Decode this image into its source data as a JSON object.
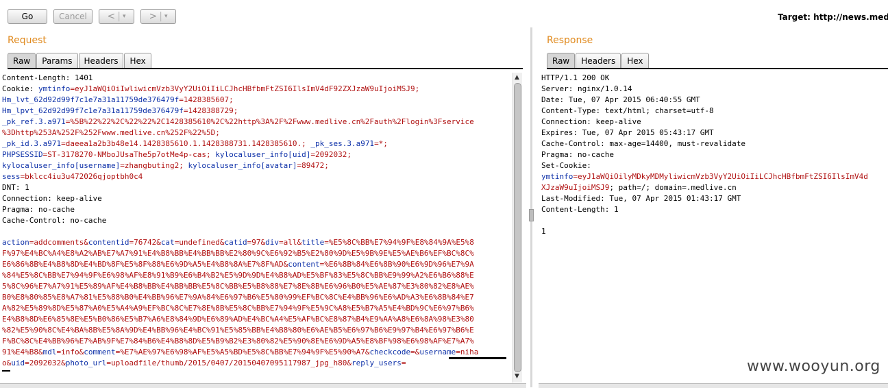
{
  "toolbar": {
    "go_label": "Go",
    "cancel_label": "Cancel",
    "back_label": "<",
    "forward_label": ">",
    "dropdown_glyph": "▾",
    "target_text": "Target: http://news.medlive.c"
  },
  "request": {
    "title": "Request",
    "tabs": [
      "Raw",
      "Params",
      "Headers",
      "Hex"
    ],
    "lines": [
      [
        {
          "t": "Content-Length: 1401",
          "c": "p"
        }
      ],
      [
        {
          "t": "Cookie: ",
          "c": "p"
        },
        {
          "t": "ymtinfo",
          "c": "k"
        },
        {
          "t": "=eyJ1aWQiOiIwliwicmVzb3VyY2UiOiIiLCJhcHBfbmFtZSI6IlsImV4dF92ZXJzaW9uIjoiMSJ9;",
          "c": "v"
        }
      ],
      [
        {
          "t": "Hm_lvt_62d92d99f7c1e7a31a11759de376479f",
          "c": "k"
        },
        {
          "t": "=1428385607;",
          "c": "v"
        }
      ],
      [
        {
          "t": "Hm_lpvt_62d92d99f7c1e7a31a11759de376479f",
          "c": "k"
        },
        {
          "t": "=1428388729;",
          "c": "v"
        }
      ],
      [
        {
          "t": "_pk_ref.3.a971",
          "c": "k"
        },
        {
          "t": "=%5B%22%22%2C%22%22%2C1428385610%2C%22http%3A%2F%2Fwww.medlive.cn%2Fauth%2Flogin%3Fservice",
          "c": "v"
        }
      ],
      [
        {
          "t": "%3Dhttp%253A%252F%252Fwww.medlive.cn%252F%22%5D;",
          "c": "v"
        }
      ],
      [
        {
          "t": "_pk_id.3.a971",
          "c": "k"
        },
        {
          "t": "=daeea1a2b3b48e14.1428385610.1.1428388731.1428385610.; ",
          "c": "v"
        },
        {
          "t": "_pk_ses.3.a971",
          "c": "k"
        },
        {
          "t": "=*;",
          "c": "v"
        }
      ],
      [
        {
          "t": "PHPSESSID",
          "c": "k"
        },
        {
          "t": "=ST-3178270-NMboJUsaThe5p7otMe4p-cas; ",
          "c": "v"
        },
        {
          "t": "kylocaluser_info[uid]",
          "c": "k"
        },
        {
          "t": "=2092032;",
          "c": "v"
        }
      ],
      [
        {
          "t": "kylocaluser_info[username]",
          "c": "k"
        },
        {
          "t": "=zhangbuting2; ",
          "c": "v"
        },
        {
          "t": "kylocaluser_info[avatar]",
          "c": "k"
        },
        {
          "t": "=89472;",
          "c": "v"
        }
      ],
      [
        {
          "t": "sess",
          "c": "k"
        },
        {
          "t": "=bklcc4iu3u472026qjoptbh0c4",
          "c": "v"
        }
      ],
      [
        {
          "t": "DNT: 1",
          "c": "p"
        }
      ],
      [
        {
          "t": "Connection: keep-alive",
          "c": "p"
        }
      ],
      [
        {
          "t": "Pragma: no-cache",
          "c": "p"
        }
      ],
      [
        {
          "t": "Cache-Control: no-cache",
          "c": "p"
        }
      ],
      [
        {
          "t": "",
          "c": "p"
        }
      ],
      [
        {
          "t": "action",
          "c": "k"
        },
        {
          "t": "=addcomments&",
          "c": "v"
        },
        {
          "t": "contentid",
          "c": "k"
        },
        {
          "t": "=76742&",
          "c": "v"
        },
        {
          "t": "cat",
          "c": "k"
        },
        {
          "t": "=undefined&",
          "c": "v"
        },
        {
          "t": "catid",
          "c": "k"
        },
        {
          "t": "=97&",
          "c": "v"
        },
        {
          "t": "div",
          "c": "k"
        },
        {
          "t": "=all&",
          "c": "v"
        },
        {
          "t": "title",
          "c": "k"
        },
        {
          "t": "=%E5%8C%BB%E7%94%9F%E8%84%9A%E5%8",
          "c": "v"
        }
      ],
      [
        {
          "t": "F%97%E4%BC%A4%E8%A2%AB%E7%A7%91%E4%B8%BB%E4%BB%BB%E2%80%9C%E6%92%B5%E2%80%9D%E5%9B%9E%E5%AE%B6%EF%BC%8C%",
          "c": "v"
        }
      ],
      [
        {
          "t": "E6%86%8B%E4%B8%8D%E4%BD%8F%E5%8F%88%E6%9D%A5%E4%B8%8A%E7%8F%AD&",
          "c": "v"
        },
        {
          "t": "content",
          "c": "k"
        },
        {
          "t": "=%E6%8B%84%E6%8B%90%E6%9D%96%E7%9A",
          "c": "v"
        }
      ],
      [
        {
          "t": "%84%E5%8C%BB%E7%94%9F%E6%98%AF%E8%91%B9%E6%B4%B2%E5%9D%9D%E4%B8%AD%E5%BF%83%E5%8C%BB%E9%99%A2%E6%B6%88%E",
          "c": "v"
        }
      ],
      [
        {
          "t": "5%8C%96%E7%A7%91%E5%89%AF%E4%B8%BB%E4%BB%BB%E5%8C%BB%E5%B8%88%E7%8E%8B%E6%96%B0%E5%AE%87%E3%80%82%E8%AE%",
          "c": "v"
        }
      ],
      [
        {
          "t": "B0%E8%80%85%E8%A7%81%E5%88%B0%E4%BB%96%E7%9A%84%E6%97%B6%E5%80%99%EF%BC%8C%E4%BB%96%E6%AD%A3%E6%8B%84%E7",
          "c": "v"
        }
      ],
      [
        {
          "t": "A%82%E5%89%8D%E5%87%A0%E5%A4%A9%EF%BC%8C%E7%8E%8B%E5%8C%BB%E7%94%9F%E5%9C%A8%E5%B7%A5%E4%BD%9C%E6%97%B6%",
          "c": "v"
        }
      ],
      [
        {
          "t": "E4%B8%8D%E6%85%8E%E5%B0%86%E5%B7%A6%E8%84%9D%E6%89%AD%E4%BC%A4%E5%AF%BC%E8%87%B4%E9%AA%A8%E6%8A%98%E3%80",
          "c": "v"
        }
      ],
      [
        {
          "t": "%82%E5%90%8C%E4%BA%8B%E5%8A%9D%E4%BB%96%E4%BC%91%E5%85%BB%E4%B8%80%E6%AE%B5%E6%97%B6%E9%97%B4%E6%97%B6%E",
          "c": "v"
        }
      ],
      [
        {
          "t": "F%BC%8C%E4%BB%96%E7%AB%9F%E7%84%B6%E4%B8%8D%E5%B9%B2%E3%80%82%E5%90%8E%E6%9D%A5%E8%BF%98%E6%98%AF%E7%A7%",
          "c": "v"
        }
      ],
      [
        {
          "t": "91%E4%B8&",
          "c": "v"
        },
        {
          "t": "mdl",
          "c": "k"
        },
        {
          "t": "=info&",
          "c": "v"
        },
        {
          "t": "comment",
          "c": "k"
        },
        {
          "t": "=%E7%AE%97%E6%98%AF%E5%A5%BD%E5%8C%BB%E7%94%9F%E5%90%A7&",
          "c": "v"
        },
        {
          "t": "checkcode",
          "c": "k"
        },
        {
          "t": "=&",
          "c": "v"
        },
        {
          "t": "username",
          "c": "k"
        },
        {
          "t": "=niha",
          "c": "v"
        }
      ],
      [
        {
          "t": "o&",
          "c": "v"
        },
        {
          "t": "uid",
          "c": "k"
        },
        {
          "t": "=2092032&",
          "c": "v"
        },
        {
          "t": "photo_url",
          "c": "k"
        },
        {
          "t": "=uploadfile/thumb/2015/0407/20150407095117987_jpg_h80&",
          "c": "v"
        },
        {
          "t": "reply_users",
          "c": "k"
        },
        {
          "t": "=",
          "c": "v"
        }
      ]
    ]
  },
  "response": {
    "title": "Response",
    "tabs": [
      "Raw",
      "Headers",
      "Hex"
    ],
    "lines": [
      [
        {
          "t": "HTTP/1.1 200 OK",
          "c": "p"
        }
      ],
      [
        {
          "t": "Server: nginx/1.0.14",
          "c": "p"
        }
      ],
      [
        {
          "t": "Date: Tue, 07 Apr 2015 06:40:55 GMT",
          "c": "p"
        }
      ],
      [
        {
          "t": "Content-Type: text/html; charset=utf-8",
          "c": "p"
        }
      ],
      [
        {
          "t": "Connection: keep-alive",
          "c": "p"
        }
      ],
      [
        {
          "t": "Expires: Tue, 07 Apr 2015 05:43:17 GMT",
          "c": "p"
        }
      ],
      [
        {
          "t": "Cache-Control: max-age=14400, must-revalidate",
          "c": "p"
        }
      ],
      [
        {
          "t": "Pragma: no-cache",
          "c": "p"
        }
      ],
      [
        {
          "t": "Set-Cookie:",
          "c": "p"
        }
      ],
      [
        {
          "t": "ymtinfo",
          "c": "k"
        },
        {
          "t": "=eyJ1aWQiOilyMDkyMDMyliwicmVzb3VyY2UiOiIiLCJhcHBfbmFtZSI6IlsImV4d",
          "c": "v"
        }
      ],
      [
        {
          "t": "XJzaW9uIjoiMSJ9",
          "c": "v"
        },
        {
          "t": "; path=/; domain=.medlive.cn",
          "c": "p"
        }
      ],
      [
        {
          "t": "Last-Modified: Tue, 07 Apr 2015 01:43:17 GMT",
          "c": "p"
        }
      ],
      [
        {
          "t": "Content-Length: 1",
          "c": "p"
        }
      ],
      [
        {
          "t": "",
          "c": "p"
        }
      ],
      [
        {
          "t": "1",
          "c": "p"
        }
      ]
    ]
  },
  "watermark": "www.wooyun.org",
  "colors": {
    "title": "#e08a1e",
    "param_name": "#0d30a8",
    "param_value": "#b01010"
  }
}
